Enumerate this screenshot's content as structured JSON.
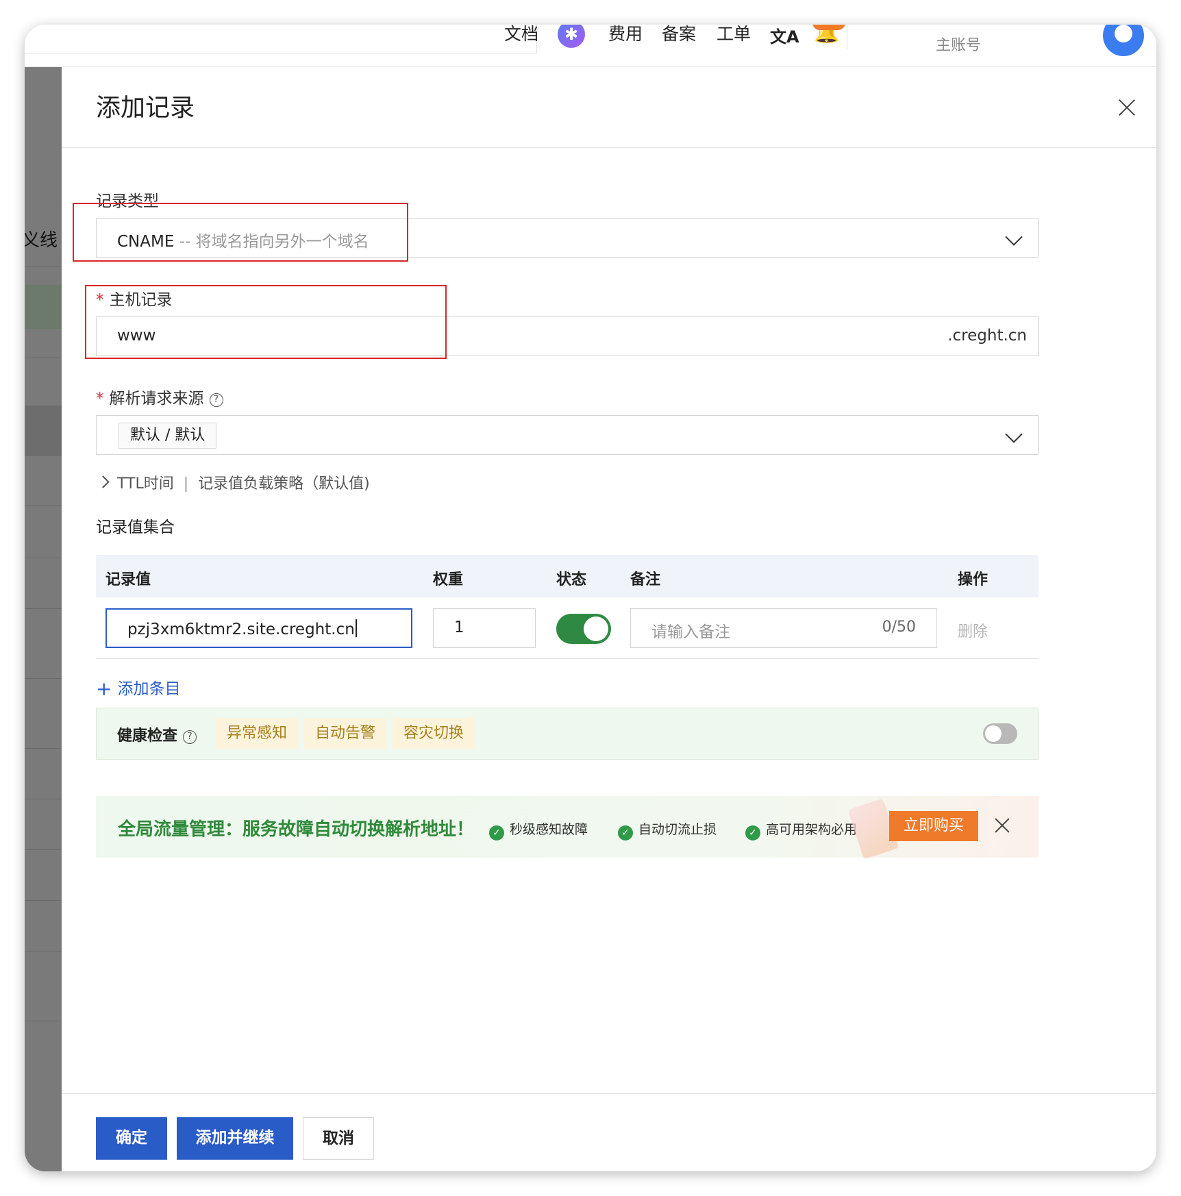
{
  "topnav": {
    "items": [
      "文档",
      "费用",
      "备案",
      "工单"
    ],
    "account_label": "主账号",
    "colors": {
      "badge": "#f07a25",
      "avatar": "#3b7cf0"
    }
  },
  "backdrop": {
    "label": "义线"
  },
  "drawer": {
    "title": "添加记录",
    "record_type": {
      "label": "记录类型",
      "value": "CNAME",
      "hint": "-- 将域名指向另外一个域名"
    },
    "host_record": {
      "label": "主机记录",
      "value": "www",
      "suffix": ".creght.cn"
    },
    "source": {
      "label": "解析请求来源",
      "tag": "默认 / 默认"
    },
    "advanced": {
      "ttl": "TTL时间",
      "strategy": "记录值负载策略（默认值)"
    },
    "value_set": {
      "title": "记录值集合",
      "headers": {
        "value": "记录值",
        "weight": "权重",
        "status": "状态",
        "note": "备注",
        "action": "操作"
      },
      "row": {
        "value": "pzj3xm6ktmr2.site.creght.cn",
        "weight": "1",
        "status_on": true,
        "note_placeholder": "请输入备注",
        "note_count": "0/50",
        "delete": "删除"
      },
      "add_entry": "添加条目"
    },
    "health_check": {
      "title": "健康检查",
      "tags": [
        "异常感知",
        "自动告警",
        "容灾切换"
      ],
      "enabled": false
    },
    "promo": {
      "headline": "全局流量管理：服务故障自动切换解析地址！",
      "features": [
        "秒级感知故障",
        "自动切流止损",
        "高可用架构必用"
      ],
      "buy": "立即购买"
    },
    "footer": {
      "confirm": "确定",
      "add_continue": "添加并继续",
      "cancel": "取消"
    }
  }
}
